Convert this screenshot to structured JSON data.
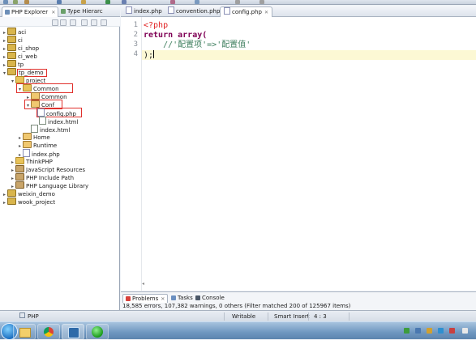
{
  "left_panel": {
    "tabs": [
      {
        "label": "PHP Explorer",
        "close": "✕"
      },
      {
        "label": "Type Hierarc"
      }
    ],
    "tree": [
      {
        "label": "aci",
        "icon": "project-icon"
      },
      {
        "label": "ci",
        "icon": "project-icon"
      },
      {
        "label": "ci_shop",
        "icon": "project-icon"
      },
      {
        "label": "ci_web",
        "icon": "project-icon"
      },
      {
        "label": "tp",
        "icon": "project-icon"
      },
      {
        "label": "tp_demo",
        "icon": "project-icon"
      },
      {
        "label": "project",
        "icon": "folder-icon"
      },
      {
        "label": "Common",
        "icon": "folder-icon"
      },
      {
        "label": "Common",
        "icon": "package-icon"
      },
      {
        "label": "Conf",
        "icon": "package-icon"
      },
      {
        "label": "config.php",
        "icon": "php-file-icon"
      },
      {
        "label": "index.html",
        "icon": "html-file-icon"
      },
      {
        "label": "index.html",
        "icon": "html-file-icon"
      },
      {
        "label": "Home",
        "icon": "package-icon"
      },
      {
        "label": "Runtime",
        "icon": "package-icon"
      },
      {
        "label": "index.php",
        "icon": "php-file-icon"
      },
      {
        "label": "ThinkPHP",
        "icon": "folder-icon"
      },
      {
        "label": "JavaScript Resources",
        "icon": "library-icon"
      },
      {
        "label": "PHP Include Path",
        "icon": "library-icon"
      },
      {
        "label": "PHP Language Library",
        "icon": "library-icon"
      },
      {
        "label": "weixin_demo",
        "icon": "project-icon"
      },
      {
        "label": "wook_project",
        "icon": "project-icon"
      }
    ]
  },
  "editor": {
    "tabs": [
      {
        "label": "index.php"
      },
      {
        "label": "convention.php"
      },
      {
        "label": "config.php",
        "close": "✕",
        "active": true
      }
    ],
    "line_numbers": [
      "1",
      "2",
      "3",
      "4"
    ],
    "code": {
      "l1_tag": "<?php",
      "l2_kw": "return",
      "l2_rest": " array(",
      "l3_comment": "    //'配置项'=>'配置值'",
      "l4_text": ");"
    },
    "bottom_marker": "◂"
  },
  "problems_panel": {
    "tabs": [
      {
        "label": "Problems",
        "close": "✕"
      },
      {
        "label": "Tasks"
      },
      {
        "label": "Console"
      }
    ],
    "summary": "18,585 errors, 107,382 warnings, 0 others (Filter matched 200 of 125967 items)"
  },
  "status_bar": {
    "perspective": "PHP",
    "writable": "Writable",
    "insert_mode": "Smart Insert",
    "cursor_position": "4 : 3"
  },
  "colors": {
    "keyword": "#7f0055",
    "php_tag": "#e02020",
    "comment": "#3f7f5f",
    "current_line": "#fcf8d4",
    "highlight_box": "#e0302c"
  }
}
